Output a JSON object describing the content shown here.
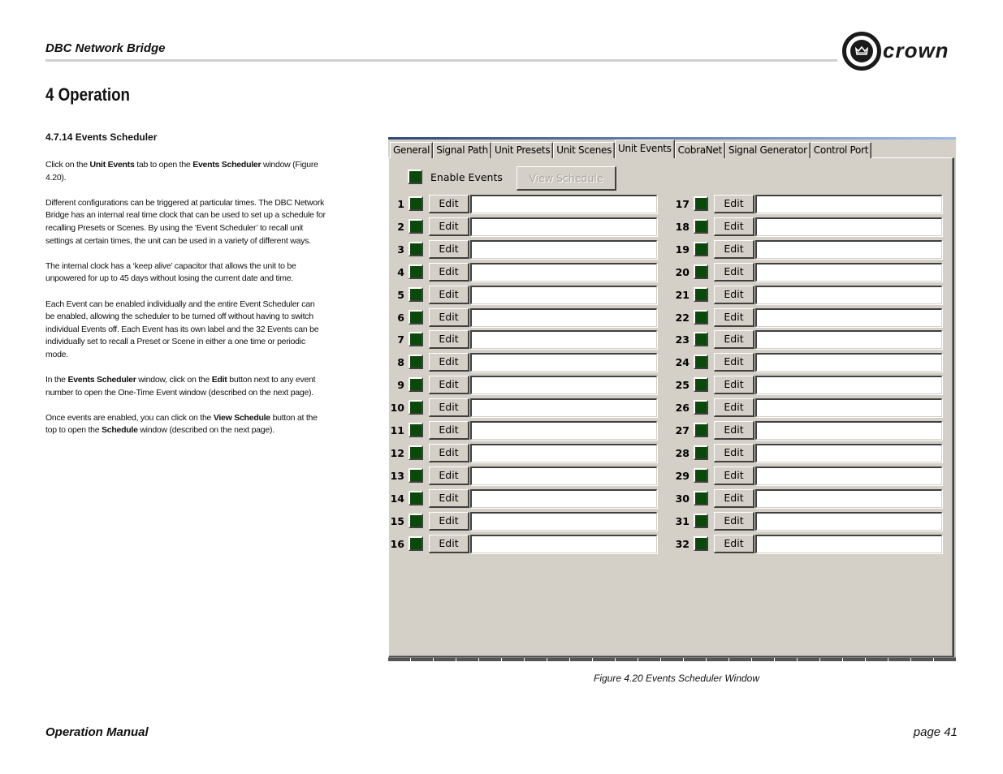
{
  "header": {
    "title": "DBC Network Bridge",
    "logo_text": "crown",
    "logo_icon": "crown-icon"
  },
  "section": {
    "title": "4 Operation",
    "subsection": "4.7.14 Events Scheduler"
  },
  "body": {
    "p1": [
      {
        "t": "Click on the "
      },
      {
        "b": "Unit Events"
      },
      {
        "t": " tab to open the "
      },
      {
        "b": "Events Scheduler"
      },
      {
        "t": " window (Figure 4.20)."
      }
    ],
    "p2": "Different configurations can be triggered at particular times. The DBC Network Bridge has an internal real time clock that can be used to set up a schedule for recalling Presets or Scenes. By using the ‘Event Scheduler’ to recall unit settings at certain times, the unit can be used in a variety of different ways.",
    "p3": "The internal clock has a ‘keep alive’ capacitor that allows the unit to be unpowered for up to 45 days without losing the current date and time.",
    "p4": "Each Event can be enabled individually and the entire Event Scheduler can be enabled, allowing the scheduler to be turned off without having to switch individual Events off. Each Event has its own label and the 32 Events can be individually set to recall a Preset or Scene in either a one time or periodic mode.",
    "p5": [
      {
        "t": "In the "
      },
      {
        "b": "Events Scheduler"
      },
      {
        "t": " window, click on the "
      },
      {
        "b": "Edit"
      },
      {
        "t": " button next to any event number to open the One-Time Event window (described on the next page)."
      }
    ],
    "p6": [
      {
        "t": "Once events are enabled, you can click on the "
      },
      {
        "b": "View Schedule"
      },
      {
        "t": " button at the top to open the "
      },
      {
        "b": "Schedule"
      },
      {
        "t": " window (described on the next page)."
      }
    ]
  },
  "window": {
    "tabs": [
      {
        "label": "General",
        "active": false
      },
      {
        "label": "Signal Path",
        "active": false
      },
      {
        "label": "Unit Presets",
        "active": false
      },
      {
        "label": "Unit Scenes",
        "active": false
      },
      {
        "label": "Unit Events",
        "active": true
      },
      {
        "label": "CobraNet",
        "active": false
      },
      {
        "label": "Signal Generator",
        "active": false
      },
      {
        "label": "Control Port",
        "active": false
      }
    ],
    "enable_events_label": "Enable Events",
    "enable_events_checked": true,
    "view_schedule_label": "View Schedule",
    "view_schedule_enabled": false,
    "edit_label": "Edit",
    "events": [
      {
        "n": "1",
        "label": ""
      },
      {
        "n": "2",
        "label": ""
      },
      {
        "n": "3",
        "label": ""
      },
      {
        "n": "4",
        "label": ""
      },
      {
        "n": "5",
        "label": ""
      },
      {
        "n": "6",
        "label": ""
      },
      {
        "n": "7",
        "label": ""
      },
      {
        "n": "8",
        "label": ""
      },
      {
        "n": "9",
        "label": ""
      },
      {
        "n": "10",
        "label": ""
      },
      {
        "n": "11",
        "label": ""
      },
      {
        "n": "12",
        "label": ""
      },
      {
        "n": "13",
        "label": ""
      },
      {
        "n": "14",
        "label": ""
      },
      {
        "n": "15",
        "label": ""
      },
      {
        "n": "16",
        "label": ""
      },
      {
        "n": "17",
        "label": ""
      },
      {
        "n": "18",
        "label": ""
      },
      {
        "n": "19",
        "label": ""
      },
      {
        "n": "20",
        "label": ""
      },
      {
        "n": "21",
        "label": ""
      },
      {
        "n": "22",
        "label": ""
      },
      {
        "n": "23",
        "label": ""
      },
      {
        "n": "24",
        "label": ""
      },
      {
        "n": "25",
        "label": ""
      },
      {
        "n": "26",
        "label": ""
      },
      {
        "n": "27",
        "label": ""
      },
      {
        "n": "28",
        "label": ""
      },
      {
        "n": "29",
        "label": ""
      },
      {
        "n": "30",
        "label": ""
      },
      {
        "n": "31",
        "label": ""
      },
      {
        "n": "32",
        "label": ""
      }
    ]
  },
  "caption": "Figure 4.20  Events Scheduler Window",
  "footer": {
    "left": "Operation Manual",
    "right": "page 41"
  }
}
